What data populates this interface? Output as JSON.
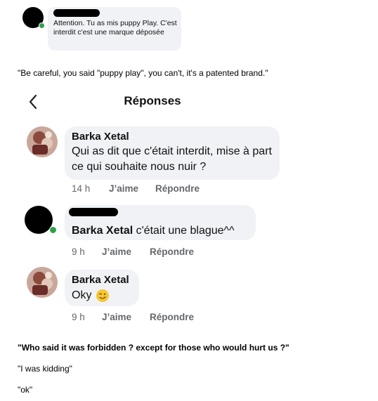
{
  "top_comment": {
    "text": "Attention. Tu as mis puppy Play. C'est interdit c'est une marque déposée"
  },
  "captions": {
    "caption1": "\"Be careful, you said \"puppy play\", you can't, it's a patented brand.\"",
    "caption2": "\"Who said it was forbidden ? except for those who would hurt us ?\"",
    "caption3": "\"I was kidding\"",
    "caption4": "\"ok\""
  },
  "header": {
    "title": "Réponses",
    "back_icon": "chevron-left-icon"
  },
  "replies": [
    {
      "name": "Barka Xetal",
      "text": "Qui as dit que c'était interdit, mise à part ce qui souhaite nous nuir ?",
      "time": "14 h",
      "like_label": "J’aime",
      "reply_label": "Répondre"
    },
    {
      "mention": "Barka Xetal",
      "text": " c'était une blague^^",
      "time": "9 h",
      "like_label": "J’aime",
      "reply_label": "Répondre"
    },
    {
      "name": "Barka Xetal",
      "text": "Oky",
      "emoji": "winking-face-icon",
      "time": "9 h",
      "like_label": "J’aime",
      "reply_label": "Répondre"
    }
  ],
  "colors": {
    "bubble": "#f0f2f5",
    "meta": "#65676b",
    "online": "#31a24c"
  }
}
